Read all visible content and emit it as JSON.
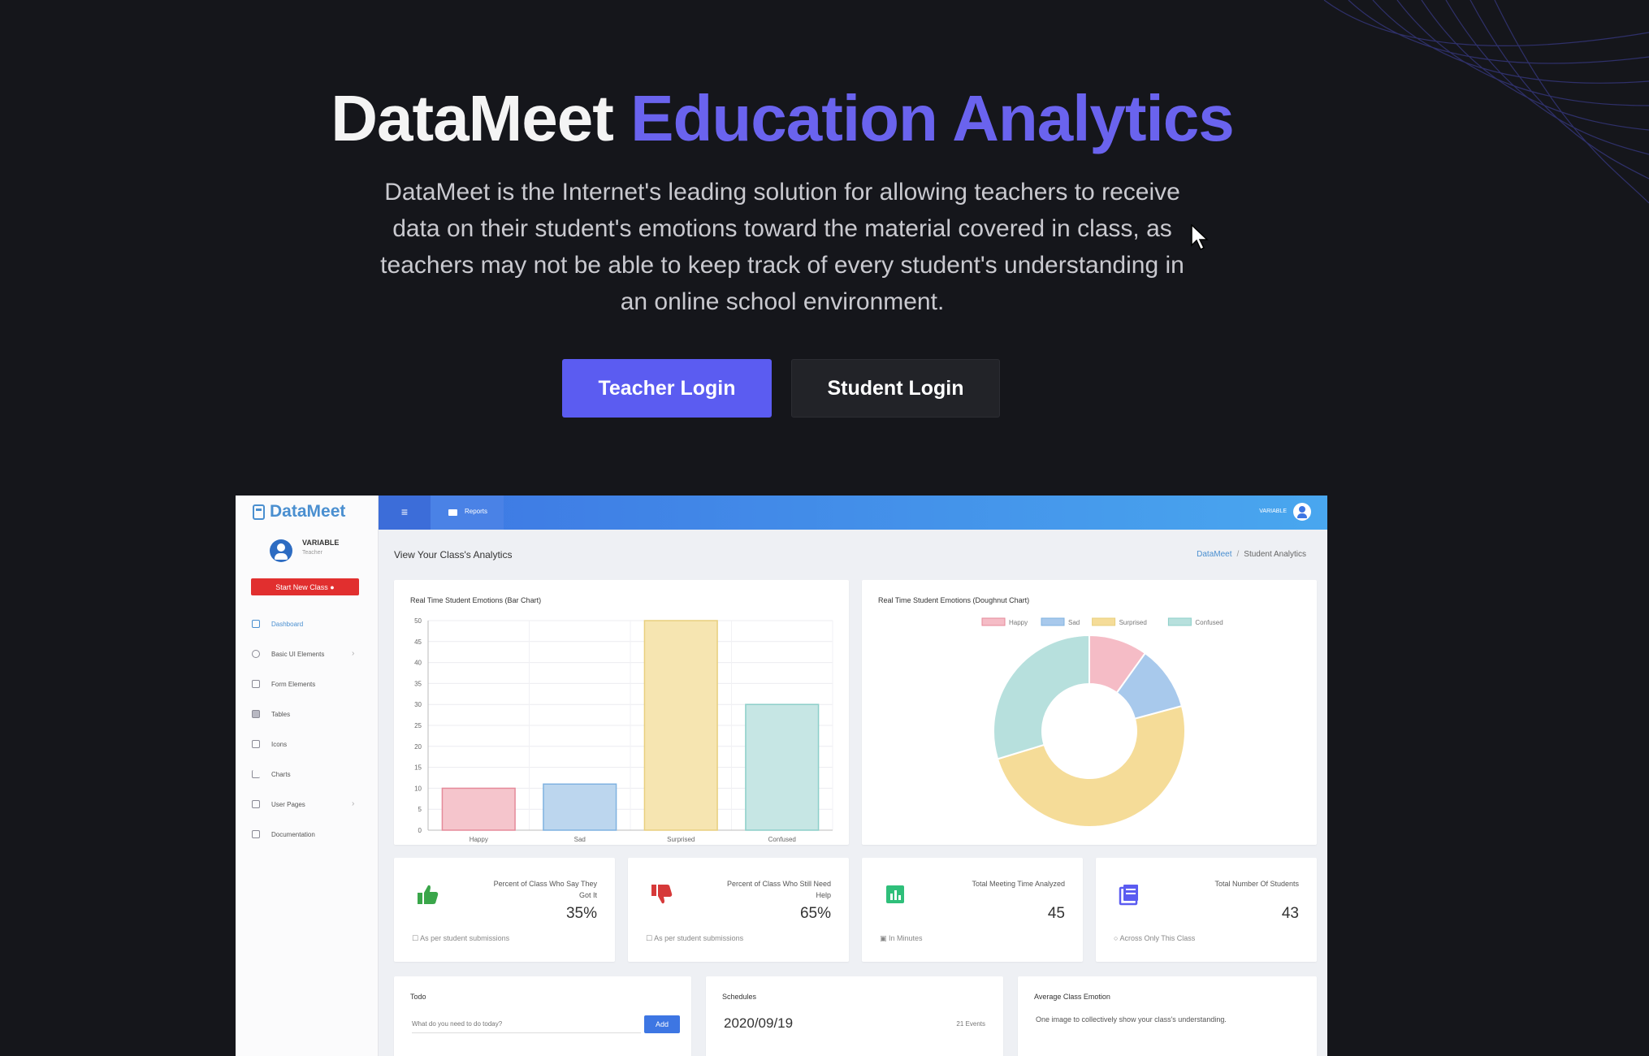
{
  "hero": {
    "title_main": "DataMeet",
    "title_accent": "Education Analytics",
    "description": "DataMeet is the Internet's leading solution for allowing teachers to receive data on their student's emotions toward the material covered in class, as teachers may not be able to keep track of every student's understanding in an online school environment.",
    "teacher_login": "Teacher Login",
    "student_login": "Student Login",
    "accent_color": "#6a63ee"
  },
  "dashboard": {
    "brand": "DataMeet",
    "user_name": "VARIABLE",
    "user_role": "Teacher",
    "start_class": "Start New Class ●",
    "nav": [
      {
        "label": "Dashboard",
        "icon": "monitor-icon"
      },
      {
        "label": "Basic UI Elements",
        "icon": "target-icon"
      },
      {
        "label": "Form Elements",
        "icon": "list-icon"
      },
      {
        "label": "Tables",
        "icon": "table-icon"
      },
      {
        "label": "Icons",
        "icon": "box-icon"
      },
      {
        "label": "Charts",
        "icon": "chart-icon"
      },
      {
        "label": "User Pages",
        "icon": "lock-icon"
      },
      {
        "label": "Documentation",
        "icon": "file-icon"
      }
    ],
    "menu_icon": "≡",
    "reports_tab": "Reports",
    "top_user": "VARIABLE",
    "page_title": "View Your Class's Analytics",
    "breadcrumb_link": "DataMeet",
    "breadcrumb_sep": "/",
    "breadcrumb_current": "Student Analytics",
    "bar_title": "Real Time Student Emotions (Bar Chart)",
    "donut_title": "Real Time Student Emotions (Doughnut Chart)",
    "stats": [
      {
        "label": "Percent of Class Who Say They Got It",
        "value": "35%",
        "foot": "As per student submissions",
        "icon": "thumbs-up-icon",
        "color": "#3aa64a"
      },
      {
        "label": "Percent of Class Who Still Need Help",
        "value": "65%",
        "foot": "As per student submissions",
        "icon": "thumbs-down-icon",
        "color": "#d63a3a"
      },
      {
        "label": "Total Meeting Time Analyzed",
        "value": "45",
        "foot": "In Minutes",
        "icon": "bar-chart-icon",
        "color": "#2fbf7a"
      },
      {
        "label": "Total Number Of Students",
        "value": "43",
        "foot": "Across Only This Class",
        "icon": "book-icon",
        "color": "#5b5cf1"
      }
    ],
    "todo_title": "Todo",
    "todo_placeholder": "What do you need to do today?",
    "todo_add": "Add",
    "schedules_title": "Schedules",
    "schedule_date": "2020/09/19",
    "schedule_count": "21 Events",
    "avg_emotion_title": "Average Class Emotion",
    "avg_emotion_sub": "One image to collectively show your class's understanding."
  },
  "chart_data": [
    {
      "type": "bar",
      "title": "Real Time Student Emotions (Bar Chart)",
      "categories": [
        "Happy",
        "Sad",
        "Surprised",
        "Confused"
      ],
      "values": [
        10,
        11,
        50,
        30
      ],
      "ylim": [
        0,
        50
      ],
      "yticks": [
        0,
        5,
        10,
        15,
        20,
        25,
        30,
        35,
        40,
        45,
        50
      ],
      "colors": [
        "#f5c5cc",
        "#bcd6ee",
        "#f6e5b1",
        "#c6e6e4"
      ],
      "borders": [
        "#e58a9a",
        "#7fb2e0",
        "#e8cf7e",
        "#8ccfc9"
      ],
      "grid": true
    },
    {
      "type": "pie",
      "title": "Real Time Student Emotions (Doughnut Chart)",
      "categories": [
        "Happy",
        "Sad",
        "Surprised",
        "Confused"
      ],
      "values": [
        10,
        11,
        50,
        30
      ],
      "colors": [
        "#f5bcc6",
        "#a8c9ec",
        "#f5dc98",
        "#b7e0dd"
      ],
      "borders": [
        "#e58a9a",
        "#7fb2e0",
        "#e8cf7e",
        "#8ccfc9"
      ],
      "legend": "top",
      "doughnut": true
    }
  ]
}
